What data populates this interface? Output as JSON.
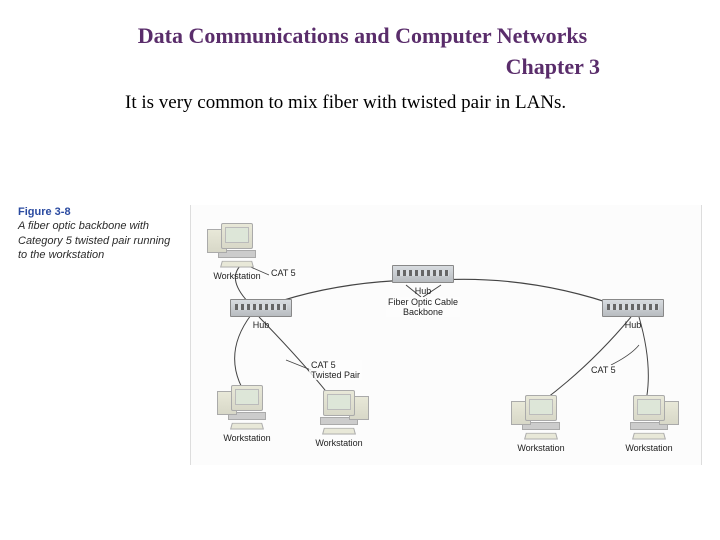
{
  "header": {
    "title": "Data Communications and Computer Networks",
    "chapter": "Chapter 3"
  },
  "body": {
    "sentence": "It is very common to mix fiber with twisted pair in LANs."
  },
  "figure": {
    "number": "Figure 3-8",
    "caption": "A fiber optic backbone with Category 5 twisted pair running to the workstation",
    "labels": {
      "workstation": "Workstation",
      "hub": "Hub",
      "cat5": "CAT 5",
      "cat5tp": "CAT 5\nTwisted Pair",
      "backbone": "Fiber Optic Cable\nBackbone"
    }
  }
}
